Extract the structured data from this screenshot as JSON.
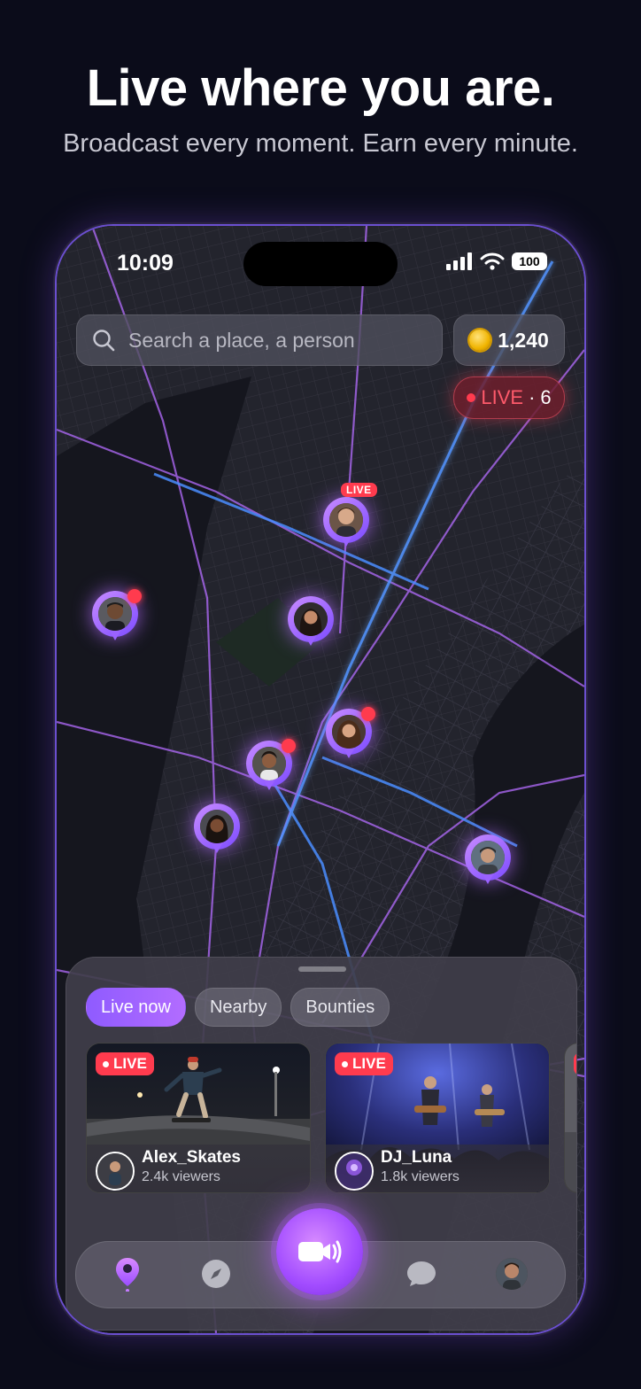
{
  "promo": {
    "headline": "Live where you are.",
    "subheadline": "Broadcast every moment. Earn every minute."
  },
  "status_bar": {
    "time": "10:09",
    "battery": "100"
  },
  "search": {
    "placeholder": "Search a place, a person"
  },
  "wallet": {
    "coins": "1,240"
  },
  "live_counter": {
    "label": "LIVE",
    "separator": "·",
    "count": "6"
  },
  "map_pins": [
    {
      "name": "pin-top-live",
      "tag": "LIVE"
    },
    {
      "name": "pin-left"
    },
    {
      "name": "pin-center"
    },
    {
      "name": "pin-center-right"
    },
    {
      "name": "pin-center-lower"
    },
    {
      "name": "pin-lower-left"
    },
    {
      "name": "pin-right"
    }
  ],
  "sheet": {
    "tabs": [
      {
        "label": "Live now",
        "active": true
      },
      {
        "label": "Nearby",
        "active": false
      },
      {
        "label": "Bounties",
        "active": false
      }
    ],
    "cards": [
      {
        "badge": "LIVE",
        "name": "Alex_Skates",
        "viewers": "2.4k viewers"
      },
      {
        "badge": "LIVE",
        "name": "DJ_Luna",
        "viewers": "1.8k viewers"
      }
    ]
  },
  "nav": {
    "items": [
      "map-pin-icon",
      "compass-icon",
      "go-live-camera-icon",
      "chat-bubble-icon",
      "profile-avatar"
    ]
  },
  "colors": {
    "accent": "#a24cff",
    "live_red": "#ff3b4e",
    "background": "#0b0c1a"
  }
}
